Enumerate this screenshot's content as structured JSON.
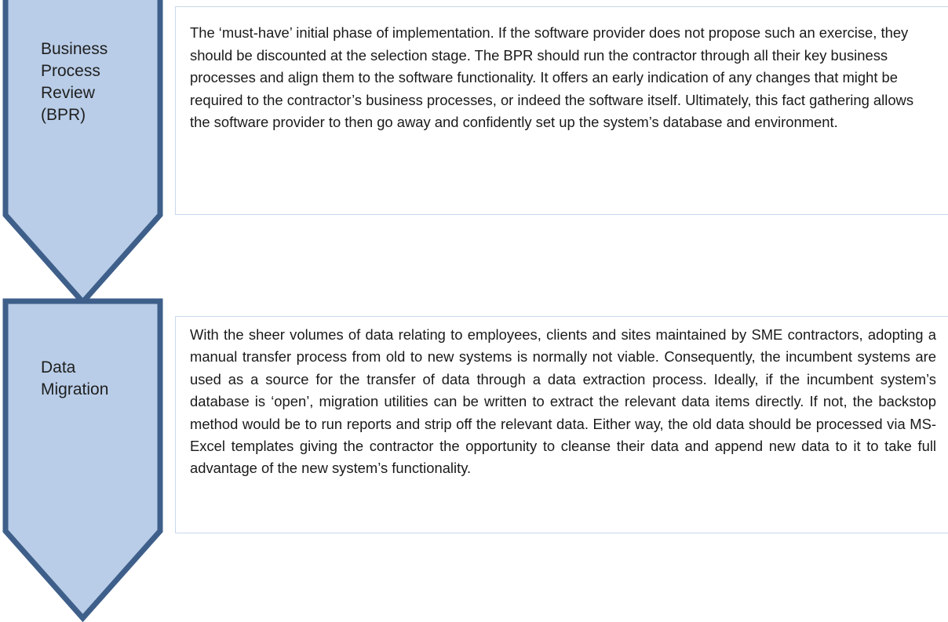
{
  "colors": {
    "chevron_fill": "#b9cde8",
    "chevron_stroke": "#3e5f8a",
    "box_border": "#c9d8ec"
  },
  "steps": [
    {
      "label_lines": [
        "Business",
        "Process",
        "Review",
        "(BPR)"
      ],
      "description": "The ‘must-have’ initial phase of implementation. If the software provider does not propose such an exercise, they should be discounted at the selection stage. The BPR should run the contractor through all their key business processes and align them to the software functionality. It offers an early indication of any changes that might be required to the contractor’s business processes, or indeed the software itself. Ultimately, this fact gathering allows the software provider to then go away and confidently set up the system’s database and environment."
    },
    {
      "label_lines": [
        "Data",
        "Migration"
      ],
      "description": "With the sheer volumes of data relating to employees, clients and sites maintained by SME contractors, adopting a manual transfer process from old to new systems is normally not viable. Consequently, the incumbent systems are used as a source for the transfer of data through a data extraction process. Ideally, if the incumbent system’s database is ‘open’, migration utilities can be written to extract the relevant data items directly. If not, the backstop method would be to run reports and strip off the relevant data. Either way, the old data should be processed via MS-Excel templates giving the contractor the opportunity to cleanse their data and append new data to it to take full advantage of the new system’s functionality."
    }
  ]
}
